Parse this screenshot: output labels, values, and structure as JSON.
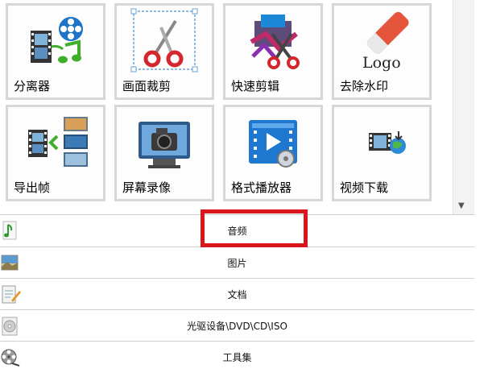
{
  "tools": [
    {
      "label": "分离器",
      "icon": "splitter-icon"
    },
    {
      "label": "画面裁剪",
      "icon": "scissors-crop-icon"
    },
    {
      "label": "快速剪辑",
      "icon": "quick-cut-icon"
    },
    {
      "label": "去除水印",
      "icon": "eraser-logo-icon"
    },
    {
      "label": "导出帧",
      "icon": "export-frames-icon"
    },
    {
      "label": "屏幕录像",
      "icon": "screen-record-icon"
    },
    {
      "label": "格式播放器",
      "icon": "format-player-icon"
    },
    {
      "label": "视频下载",
      "icon": "video-download-icon"
    }
  ],
  "logo_text": "Logo",
  "categories": [
    {
      "label": "音频",
      "icon": "music-note-icon"
    },
    {
      "label": "图片",
      "icon": "picture-icon"
    },
    {
      "label": "文档",
      "icon": "document-icon"
    },
    {
      "label": "光驱设备\\DVD\\CD\\ISO",
      "icon": "disc-icon"
    },
    {
      "label": "工具集",
      "icon": "film-reel-icon"
    }
  ],
  "colors": {
    "highlight": "#d9161c",
    "tile_border": "#d7d7d7",
    "row_border": "#cfcfcf"
  }
}
